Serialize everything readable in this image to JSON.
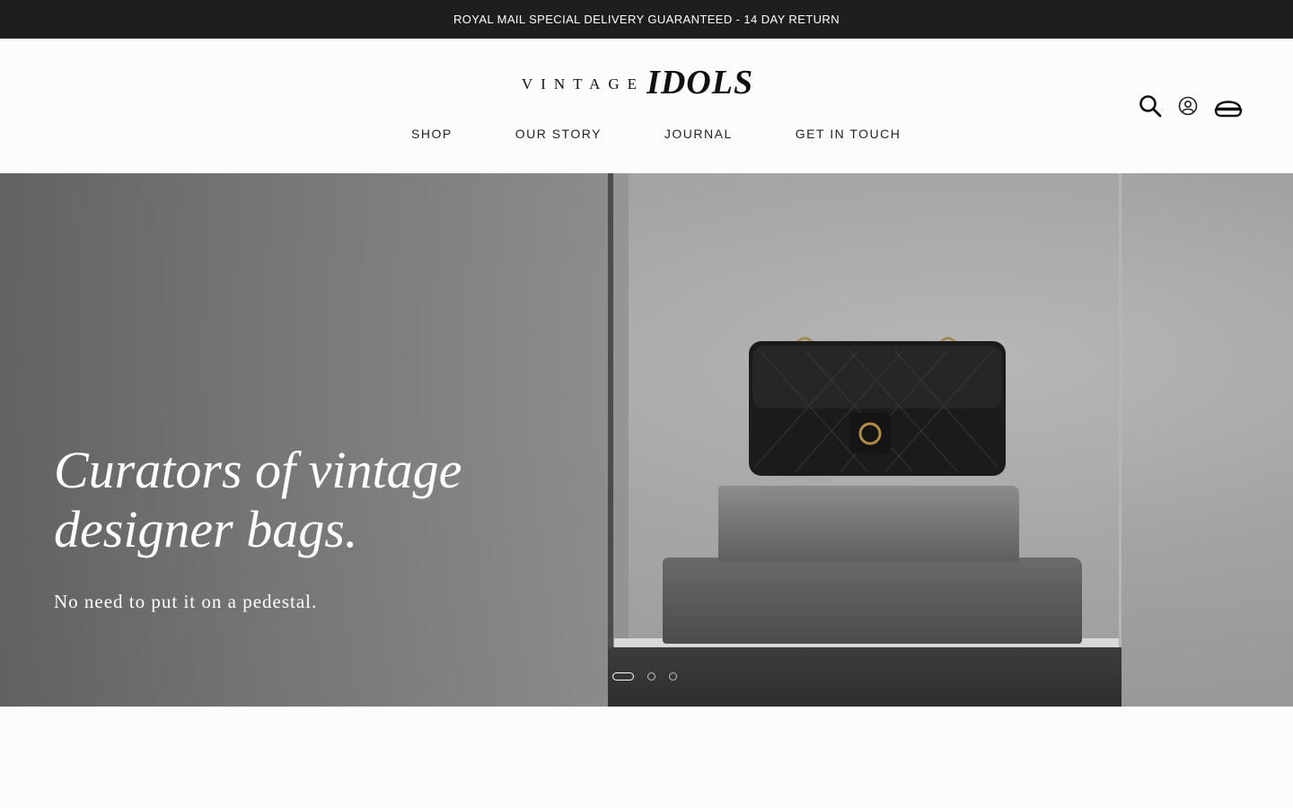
{
  "announcement": "ROYAL MAIL SPECIAL DELIVERY GUARANTEED - 14 DAY RETURN",
  "logo": {
    "small": "VINTAGE",
    "big": "IDOLS"
  },
  "nav": {
    "items": [
      {
        "label": "SHOP"
      },
      {
        "label": "OUR STORY"
      },
      {
        "label": "JOURNAL"
      },
      {
        "label": "GET IN TOUCH"
      }
    ]
  },
  "header_icons": [
    "search-icon",
    "account-icon",
    "cart-icon"
  ],
  "hero": {
    "title": "Curators of vintage designer bags.",
    "subtitle": "No need to put it on a pedestal.",
    "slides_total": 3,
    "active_slide": 1
  },
  "colors": {
    "announcement_bg": "#1d1e20",
    "page_bg": "#fcfcfc",
    "hero_text": "#ffffff"
  }
}
